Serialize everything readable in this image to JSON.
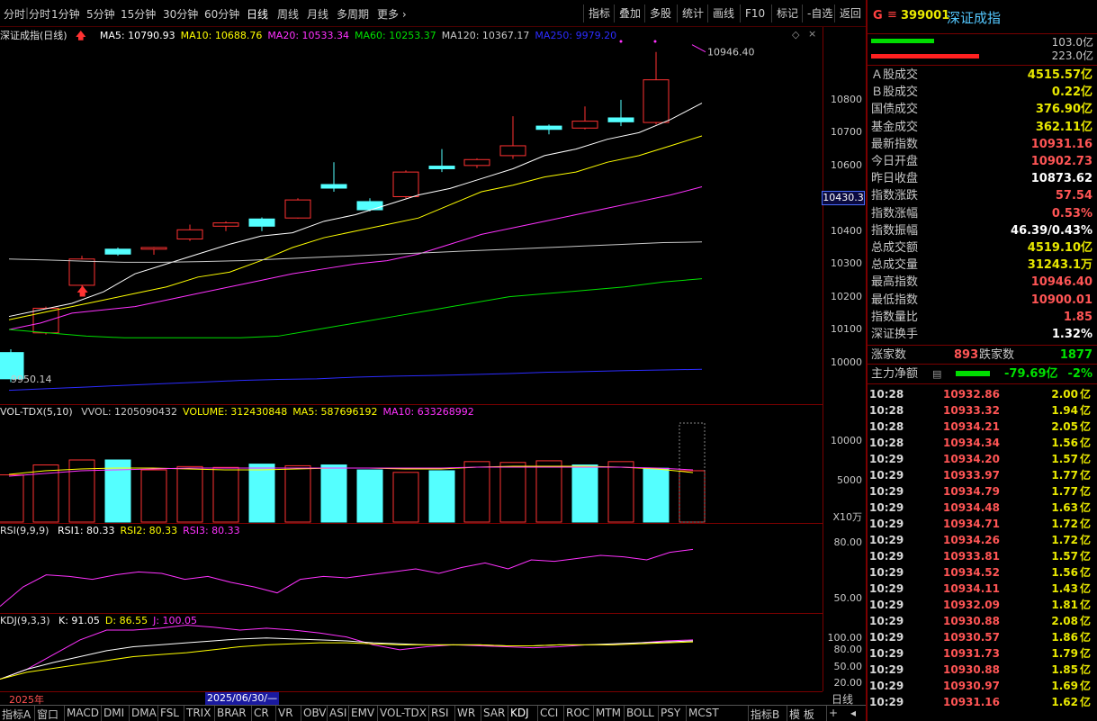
{
  "toolbar": {
    "periods": [
      "分时",
      "1分钟",
      "5分钟",
      "15分钟",
      "30分钟",
      "60分钟",
      "日线",
      "周线",
      "月线",
      "多周期",
      "更多"
    ],
    "active_period": "日线",
    "right_buttons": [
      "指标",
      "叠加",
      "多股",
      "统计",
      "画线",
      "F10",
      "标记",
      "-自选",
      "返回"
    ]
  },
  "colors": {
    "up": "#ff3232",
    "down": "#54ffff",
    "ma5": "#ffffff",
    "ma10": "#ffff00",
    "ma20": "#ff32ff",
    "ma60": "#00e000",
    "ma120": "#c8c8c8",
    "ma250": "#2c2cff"
  },
  "main_chart": {
    "title": "深证成指(日线)",
    "ma": [
      {
        "label": "MA5: 10790.93",
        "color": "#ffffff"
      },
      {
        "label": "MA10: 10688.76",
        "color": "#ffff00"
      },
      {
        "label": "MA20: 10533.34",
        "color": "#ff32ff"
      },
      {
        "label": "MA60: 10253.37",
        "color": "#00e000"
      },
      {
        "label": "MA120: 10367.17",
        "color": "#c8c8c8"
      },
      {
        "label": "MA250: 9979.20",
        "color": "#2c2cff"
      }
    ],
    "high_note": "10946.40",
    "low_note": "9950.14",
    "price_levels": [
      "10800",
      "10700",
      "10600",
      "10500",
      "10400",
      "10300",
      "10200",
      "10100",
      "10000"
    ],
    "current_price": "10430.3"
  },
  "candles": [
    {
      "o": 10030,
      "c": 9950,
      "h": 10040,
      "l": 9940
    },
    {
      "o": 10090,
      "c": 10165,
      "h": 10170,
      "l": 10085
    },
    {
      "o": 10235,
      "c": 10315,
      "h": 10325,
      "l": 10230
    },
    {
      "o": 10345,
      "c": 10330,
      "h": 10350,
      "l": 10325
    },
    {
      "o": 10345,
      "c": 10350,
      "h": 10352,
      "l": 10328
    },
    {
      "o": 10376,
      "c": 10404,
      "h": 10420,
      "l": 10370
    },
    {
      "o": 10415,
      "c": 10425,
      "h": 10430,
      "l": 10400
    },
    {
      "o": 10437,
      "c": 10415,
      "h": 10442,
      "l": 10400
    },
    {
      "o": 10440,
      "c": 10495,
      "h": 10500,
      "l": 10438
    },
    {
      "o": 10542,
      "c": 10531,
      "h": 10610,
      "l": 10520
    },
    {
      "o": 10490,
      "c": 10465,
      "h": 10500,
      "l": 10460
    },
    {
      "o": 10505,
      "c": 10580,
      "h": 10585,
      "l": 10500
    },
    {
      "o": 10598,
      "c": 10590,
      "h": 10650,
      "l": 10580
    },
    {
      "o": 10600,
      "c": 10618,
      "h": 10622,
      "l": 10592
    },
    {
      "o": 10630,
      "c": 10660,
      "h": 10750,
      "l": 10620
    },
    {
      "o": 10720,
      "c": 10710,
      "h": 10725,
      "l": 10695
    },
    {
      "o": 10714,
      "c": 10735,
      "h": 10780,
      "l": 10710
    },
    {
      "o": 10745,
      "c": 10733,
      "h": 10800,
      "l": 10720
    },
    {
      "o": 10731,
      "c": 10861,
      "h": 10946,
      "l": 10725
    }
  ],
  "volume": {
    "title": "VOL-TDX(5,10)",
    "labels": [
      {
        "text": "VVOL: 1205090432",
        "color": "#c8c8c8"
      },
      {
        "text": "VOLUME: 312430848",
        "color": "#ffff00"
      },
      {
        "text": "MA5: 587696192",
        "color": "#ffff00"
      },
      {
        "text": "MA10: 633268992",
        "color": "#ff32ff"
      }
    ],
    "values": [
      5700,
      6900,
      7500,
      7500,
      6300,
      6700,
      6600,
      7000,
      6800,
      6900,
      6300,
      6000,
      6200,
      7300,
      7200,
      7400,
      6900,
      7300,
      6500,
      6200,
      3400
    ],
    "axis_ticks": [
      "10000",
      "5000"
    ],
    "unit": "X10万"
  },
  "rsi": {
    "title": "RSI(9,9,9)",
    "labels": [
      {
        "text": "RSI1: 80.33",
        "color": "#ffffff"
      },
      {
        "text": "RSI2: 80.33",
        "color": "#ffff00"
      },
      {
        "text": "RSI3: 80.33",
        "color": "#ff32ff"
      }
    ],
    "values": [
      42,
      55,
      63,
      62,
      60,
      63,
      65,
      64,
      60,
      62,
      58,
      55,
      51,
      60,
      62,
      61,
      63,
      65,
      67,
      64,
      68,
      71,
      67,
      73,
      72,
      74,
      76,
      75,
      73,
      78,
      80
    ],
    "axis_ticks": [
      "80.00",
      "50.00"
    ]
  },
  "kdj": {
    "title": "KDJ(9,3,3)",
    "labels": [
      {
        "text": "K: 91.05",
        "color": "#ffffff"
      },
      {
        "text": "D: 86.55",
        "color": "#ffff00"
      },
      {
        "text": "J: 100.05",
        "color": "#ff32ff"
      }
    ],
    "axis_ticks": [
      "100.00",
      "80.00",
      "50.00",
      "20.00"
    ]
  },
  "date_marks": {
    "year": "2025年",
    "cursor_date": "2025/06/30/—",
    "period_label": "日线"
  },
  "bottom_tabs": [
    "指标A",
    "窗口",
    "MACD",
    "DMI",
    "DMA",
    "FSL",
    "TRIX",
    "BRAR",
    "CR",
    "VR",
    "OBV",
    "ASI",
    "EMV",
    "VOL-TDX",
    "RSI",
    "WR",
    "SAR",
    "KDJ",
    "CCI",
    "ROC",
    "MTM",
    "BOLL",
    "PSY",
    "MCST",
    "指标B",
    "模 板",
    "+"
  ],
  "selected_tab": "KDJ",
  "quote": {
    "badge": "G",
    "code": "399001",
    "name": "深证成指",
    "buy_amount": "103.0亿",
    "sell_amount": "223.0亿",
    "rows": [
      {
        "k": "Ａ股成交",
        "v": "4515.57亿",
        "c": "#e8e800"
      },
      {
        "k": "Ｂ股成交",
        "v": "0.22亿",
        "c": "#e8e800"
      },
      {
        "k": "国债成交",
        "v": "376.90亿",
        "c": "#e8e800"
      },
      {
        "k": "基金成交",
        "v": "362.11亿",
        "c": "#e8e800"
      },
      {
        "k": "最新指数",
        "v": "10931.16",
        "c": "#ff5555"
      },
      {
        "k": "今日开盘",
        "v": "10902.73",
        "c": "#ff5555"
      },
      {
        "k": "昨日收盘",
        "v": "10873.62",
        "c": "#ffffff"
      },
      {
        "k": "指数涨跌",
        "v": "57.54",
        "c": "#ff5555"
      },
      {
        "k": "指数涨幅",
        "v": "0.53%",
        "c": "#ff5555"
      },
      {
        "k": "指数振幅",
        "v": "46.39/0.43%",
        "c": "#ffffff"
      },
      {
        "k": "总成交额",
        "v": "4519.10亿",
        "c": "#e8e800"
      },
      {
        "k": "总成交量",
        "v": "31243.1万",
        "c": "#e8e800"
      },
      {
        "k": "最高指数",
        "v": "10946.40",
        "c": "#ff5555"
      },
      {
        "k": "最低指数",
        "v": "10900.01",
        "c": "#ff5555"
      },
      {
        "k": "指数量比",
        "v": "1.85",
        "c": "#ff5555"
      },
      {
        "k": "深证换手",
        "v": "1.32%",
        "c": "#ffffff"
      }
    ],
    "adv_label": "涨家数",
    "adv": "893",
    "dec_label": "跌家数",
    "dec": "1877",
    "flow_label": "主力净额",
    "flow_value": "-79.69亿",
    "flow_pct": "-2%"
  },
  "ticks": [
    {
      "t": "10:28",
      "p": "10932.86",
      "a": "2.00"
    },
    {
      "t": "10:28",
      "p": "10933.32",
      "a": "1.94"
    },
    {
      "t": "10:28",
      "p": "10934.21",
      "a": "2.05"
    },
    {
      "t": "10:28",
      "p": "10934.34",
      "a": "1.56"
    },
    {
      "t": "10:29",
      "p": "10934.20",
      "a": "1.57"
    },
    {
      "t": "10:29",
      "p": "10933.97",
      "a": "1.77"
    },
    {
      "t": "10:29",
      "p": "10934.79",
      "a": "1.77"
    },
    {
      "t": "10:29",
      "p": "10934.48",
      "a": "1.63"
    },
    {
      "t": "10:29",
      "p": "10934.71",
      "a": "1.72"
    },
    {
      "t": "10:29",
      "p": "10934.26",
      "a": "1.72"
    },
    {
      "t": "10:29",
      "p": "10933.81",
      "a": "1.57"
    },
    {
      "t": "10:29",
      "p": "10934.52",
      "a": "1.56"
    },
    {
      "t": "10:29",
      "p": "10934.11",
      "a": "1.43"
    },
    {
      "t": "10:29",
      "p": "10932.09",
      "a": "1.81"
    },
    {
      "t": "10:29",
      "p": "10930.88",
      "a": "2.08"
    },
    {
      "t": "10:29",
      "p": "10930.57",
      "a": "1.86"
    },
    {
      "t": "10:29",
      "p": "10931.73",
      "a": "1.79"
    },
    {
      "t": "10:29",
      "p": "10930.88",
      "a": "1.85"
    },
    {
      "t": "10:29",
      "p": "10930.97",
      "a": "1.69"
    },
    {
      "t": "10:29",
      "p": "10931.16",
      "a": "1.62"
    }
  ],
  "tick_unit": "亿"
}
